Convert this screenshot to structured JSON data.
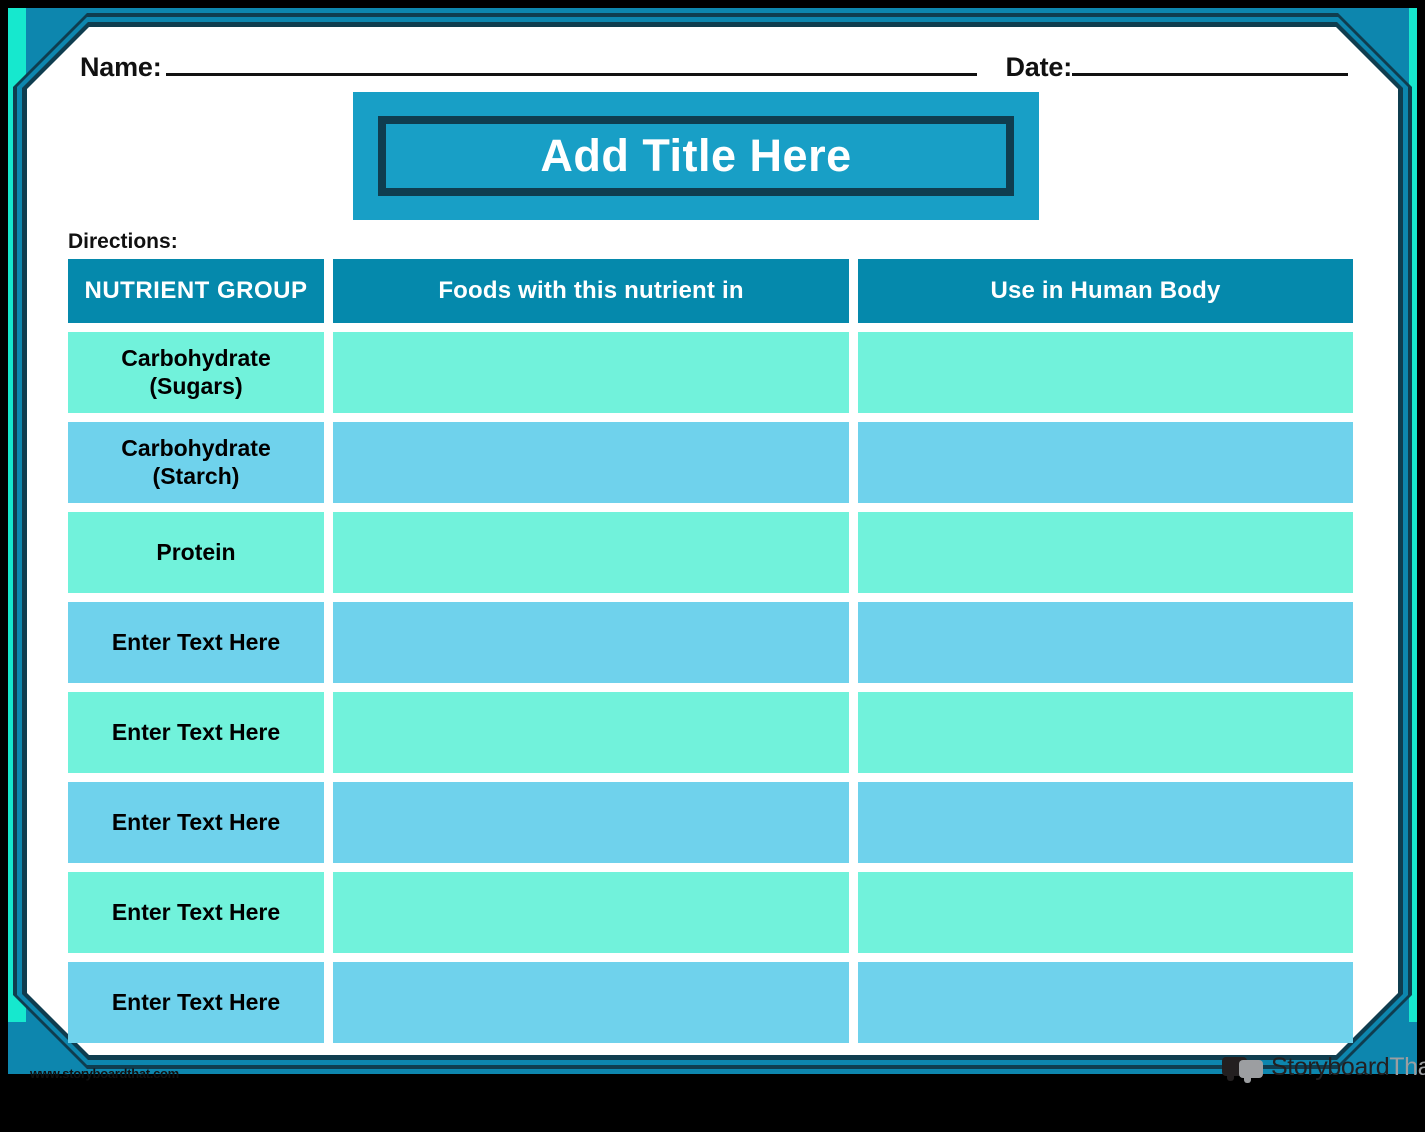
{
  "worksheet": {
    "header": {
      "name_label": "Name:",
      "date_label": "Date:"
    },
    "title": "Add Title Here",
    "directions_label": "Directions:",
    "table": {
      "columns": [
        "NUTRIENT GROUP",
        "Foods with this nutrient in",
        "Use in Human Body"
      ],
      "rows": [
        {
          "nutrient_group": "Carbohydrate\n(Sugars)",
          "foods": "",
          "use": "",
          "tone": "mint"
        },
        {
          "nutrient_group": "Carbohydrate\n(Starch)",
          "foods": "",
          "use": "",
          "tone": "sky"
        },
        {
          "nutrient_group": "Protein",
          "foods": "",
          "use": "",
          "tone": "mint"
        },
        {
          "nutrient_group": "Enter Text Here",
          "foods": "",
          "use": "",
          "tone": "sky"
        },
        {
          "nutrient_group": "Enter Text Here",
          "foods": "",
          "use": "",
          "tone": "mint"
        },
        {
          "nutrient_group": "Enter Text Here",
          "foods": "",
          "use": "",
          "tone": "sky"
        },
        {
          "nutrient_group": "Enter Text Here",
          "foods": "",
          "use": "",
          "tone": "mint"
        },
        {
          "nutrient_group": "Enter Text Here",
          "foods": "",
          "use": "",
          "tone": "sky"
        }
      ]
    },
    "footer": {
      "site_url": "www.storyboardthat.com",
      "logo_primary": "Storyboard",
      "logo_secondary": "That"
    },
    "colors": {
      "frame_black": "#000000",
      "frame_turquoise": "#16E8CE",
      "frame_teal": "#0D86AE",
      "frame_navy": "#0F3D4F",
      "title_box": "#189FC6",
      "header_cell": "#0589AC",
      "row_mint": "#71F2DB",
      "row_sky": "#6FD2EC",
      "page_white": "#FFFFFF",
      "text_black": "#000000",
      "text_white": "#FFFFFF",
      "logo_dark": "#231F20",
      "logo_gray": "#9C9EA1"
    }
  }
}
